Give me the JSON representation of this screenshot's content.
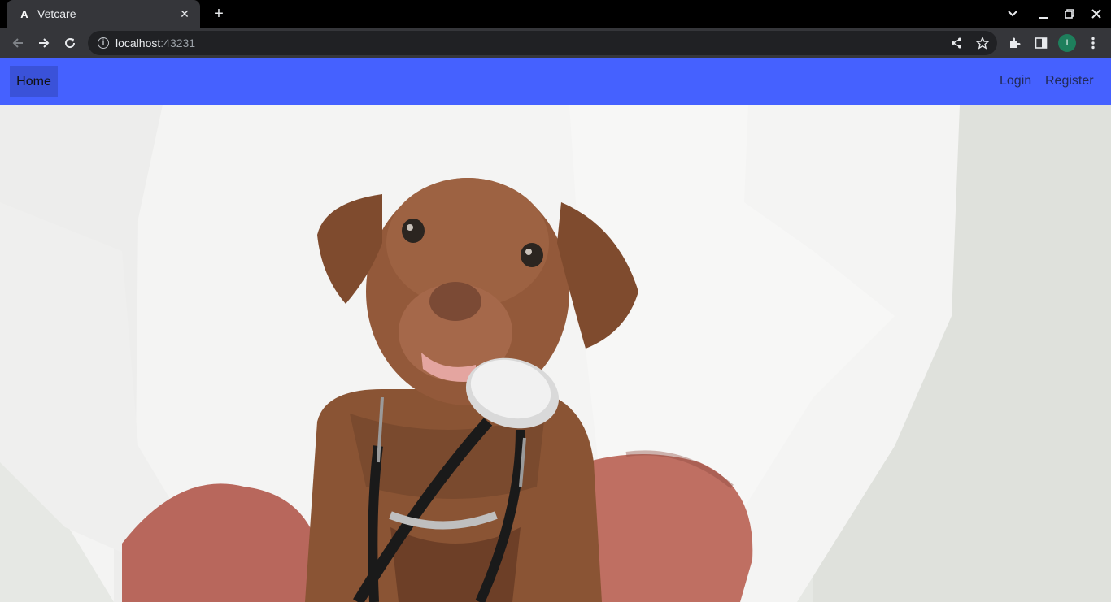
{
  "browser": {
    "tab": {
      "title": "Vetcare",
      "favicon": "A"
    },
    "new_tab_icon": "plus-icon",
    "url": {
      "host": "localhost",
      "port": ":43231"
    },
    "profile_initial": "I"
  },
  "app": {
    "nav": {
      "home_label": "Home",
      "login_label": "Login",
      "register_label": "Register"
    },
    "hero": {
      "image_description_icon": "puppy-with-stethoscope-photo"
    }
  },
  "colors": {
    "navbar": "#4561ff",
    "home_active": "#3a52d9",
    "chrome_dark": "#35363a"
  }
}
